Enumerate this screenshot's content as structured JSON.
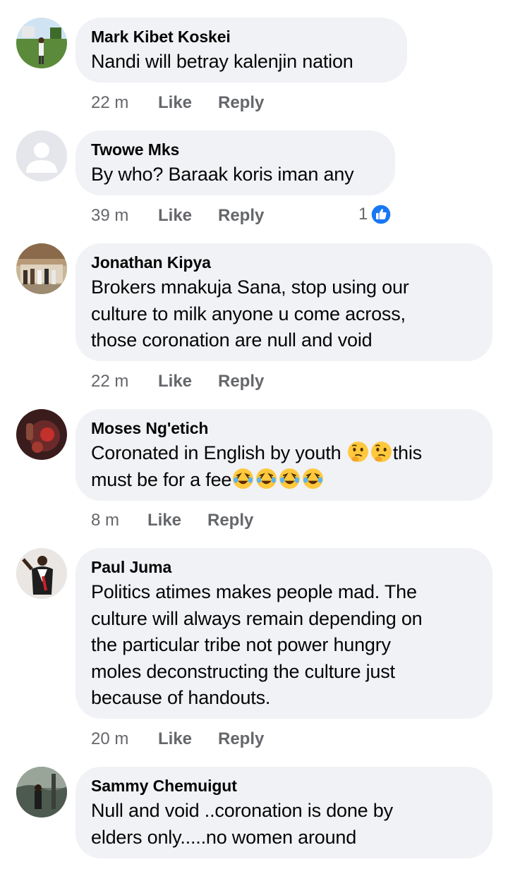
{
  "comments": [
    {
      "author": "Mark Kibet Koskei",
      "text": "Nandi will betray kalenjin nation",
      "time": "22 m",
      "like": "Like",
      "reply": "Reply"
    },
    {
      "author": "Twowe Mks",
      "text": "By who? Baraak koris iman any",
      "time": "39 m",
      "like": "Like",
      "reply": "Reply",
      "reaction_count": "1",
      "reaction_icon": "thumbs-up-icon",
      "reaction_color": "#1877f2"
    },
    {
      "author": "Jonathan Kipya",
      "text_lines": [
        "Brokers mnakuja Sana, stop using our",
        "culture to milk anyone u come across,",
        "those coronation are null and void"
      ],
      "time": "22 m",
      "like": "Like",
      "reply": "Reply"
    },
    {
      "author": "Moses Ng'etich",
      "text_line1_a": "Coronated in English by youth ",
      "text_line1_b": "this",
      "text_line2": "must be for a fee",
      "emojis_line1": [
        "thinking-face-emoji",
        "thinking-face-emoji"
      ],
      "emojis_line2": [
        "rolling-laughing-emoji",
        "rolling-laughing-emoji",
        "rolling-laughing-emoji",
        "rolling-laughing-emoji"
      ],
      "time": "8 m",
      "like": "Like",
      "reply": "Reply"
    },
    {
      "author": "Paul Juma",
      "text_lines": [
        "Politics atimes makes people mad. The",
        "culture will always remain depending on",
        "the particular tribe not power hungry",
        "moles deconstructing the culture just",
        "because of handouts."
      ],
      "time": "20 m",
      "like": "Like",
      "reply": "Reply"
    },
    {
      "author": "Sammy Chemuigut",
      "text_lines": [
        "Null and void ..coronation is done by",
        "elders only.....no women around"
      ]
    }
  ],
  "colors": {
    "bubble": "#f0f2f5",
    "meta_text": "#65676b",
    "like_blue": "#1877f2",
    "emoji_yellow": "#ffc83d"
  }
}
